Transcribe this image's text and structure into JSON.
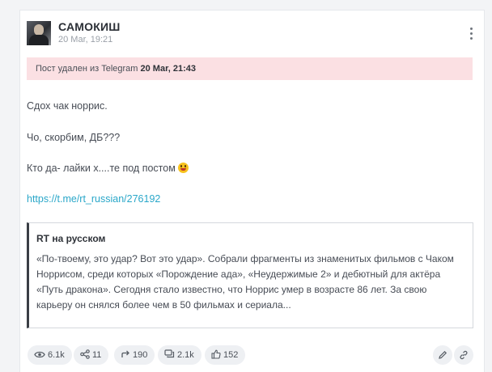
{
  "post": {
    "author": "САМОКИШ",
    "time": "20 Mar, 19:21",
    "deleted_prefix": "Пост удален из Telegram ",
    "deleted_time": "20 Mar, 21:43",
    "lines": [
      "Сдох чак норрис.",
      "Чо, скорбим, ДБ???",
      "Кто да- лайки х....те под постом"
    ],
    "link": "https://t.me/rt_russian/276192",
    "quote": {
      "source": "RT на русском",
      "text": "«По-твоему, это удар? Вот это удар». Собрали фрагменты из знаменитых фильмов с Чаком Норрисом, среди которых «Порождение ада», «Неудержимые 2» и дебютный для актёра «Путь дракона». Сегодня стало известно, что Норрис умер в возрасте 86 лет. За свою карьеру он снялся более чем в 50 фильмах и сериала..."
    }
  },
  "stats": {
    "views": "6.1k",
    "shares": "11",
    "forwards": "190",
    "comments": "2.1k",
    "likes": "152"
  },
  "icons": {
    "views": "eye-icon",
    "shares": "share-icon",
    "forwards": "forward-icon",
    "comments": "comments-icon",
    "likes": "thumbs-up-icon",
    "edit": "pencil-icon",
    "copy_link": "link-icon",
    "more": "more-vertical-icon",
    "emoji": "grinning-tongue-emoji"
  },
  "colors": {
    "banner_bg": "#fbe0e3",
    "link": "#2aa7c9",
    "pill_bg": "#eef0f3"
  }
}
